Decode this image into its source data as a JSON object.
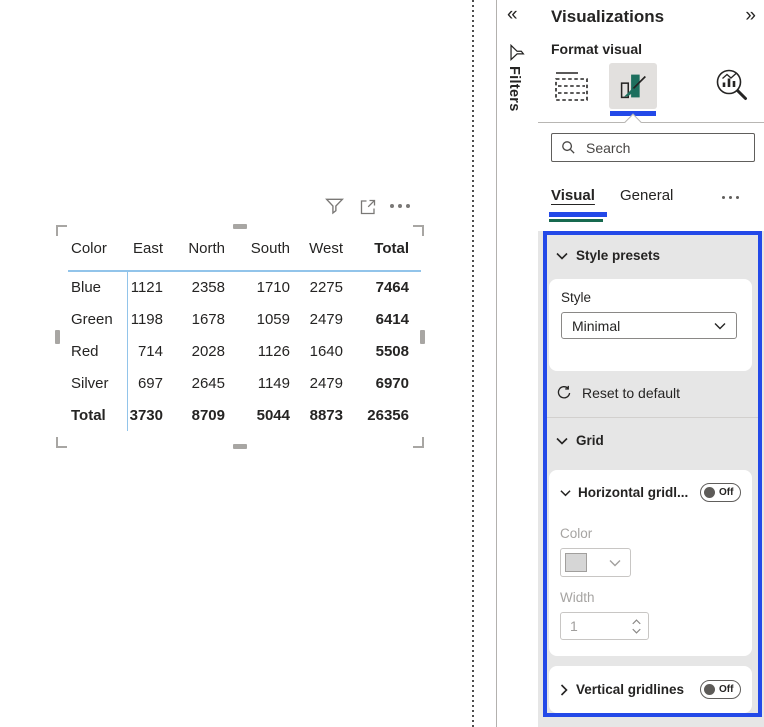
{
  "colors": {
    "accent_blue": "#2349e8",
    "accent_green": "#17694f",
    "teal_icon": "#1d6f5e",
    "table_line_blue": "#92c4ea",
    "panel_gray": "#e6e6e6"
  },
  "canvas": {
    "table": {
      "columns": [
        "Color",
        "East",
        "North",
        "South",
        "West",
        "Total"
      ],
      "rows": [
        {
          "label": "Blue",
          "values": [
            "1121",
            "2358",
            "1710",
            "2275",
            "7464"
          ]
        },
        {
          "label": "Green",
          "values": [
            "1198",
            "1678",
            "1059",
            "2479",
            "6414"
          ]
        },
        {
          "label": "Red",
          "values": [
            "714",
            "2028",
            "1126",
            "1640",
            "5508"
          ]
        },
        {
          "label": "Silver",
          "values": [
            "697",
            "2645",
            "1149",
            "2479",
            "6970"
          ]
        },
        {
          "label": "Total",
          "values": [
            "3730",
            "8709",
            "5044",
            "8873",
            "26356"
          ]
        }
      ]
    }
  },
  "filters_pane": {
    "collapse_glyph": "«",
    "title": "Filters"
  },
  "viz_pane": {
    "title": "Visualizations",
    "expand_glyph": "»",
    "subtitle": "Format visual",
    "search": {
      "placeholder": "Search"
    },
    "tabs": {
      "visual": "Visual",
      "general": "General"
    },
    "style_presets": {
      "title": "Style presets",
      "style_label": "Style",
      "style_value": "Minimal",
      "reset_label": "Reset to default"
    },
    "grid": {
      "title": "Grid",
      "horizontal": {
        "title": "Horizontal gridl...",
        "toggle_label": "Off",
        "color_label": "Color",
        "width_label": "Width",
        "width_value": "1"
      },
      "vertical": {
        "title": "Vertical gridlines",
        "toggle_label": "Off"
      }
    }
  }
}
